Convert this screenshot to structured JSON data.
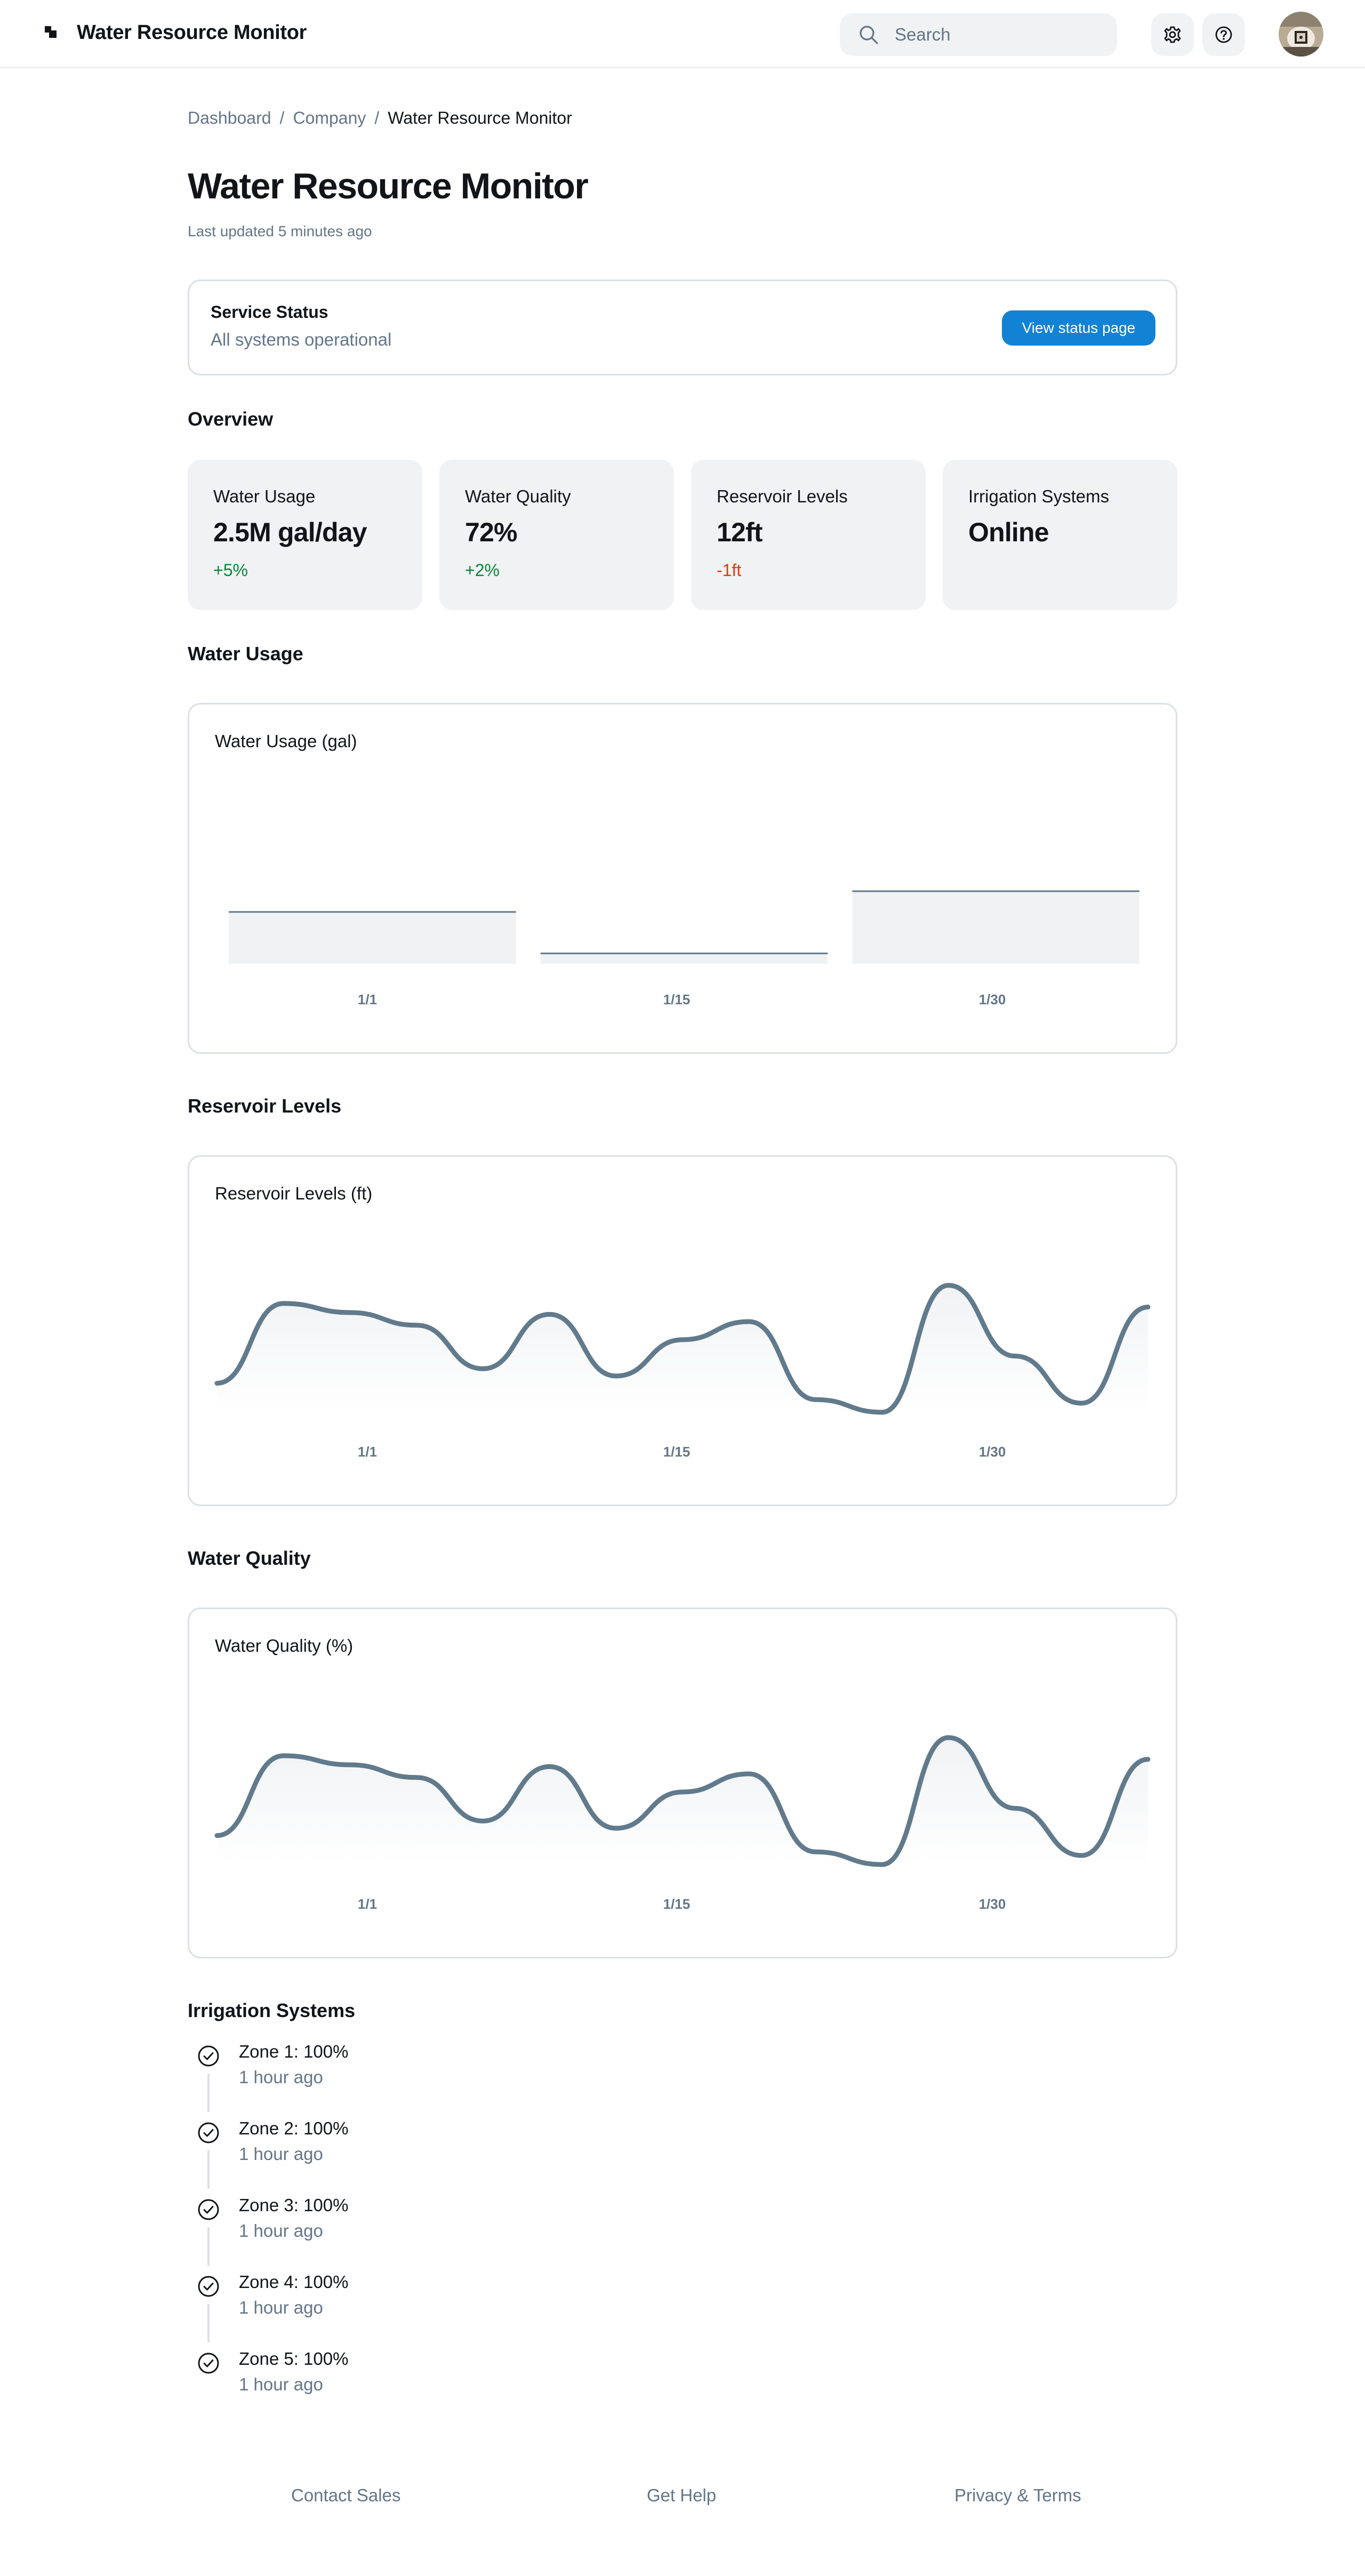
{
  "header": {
    "app_title": "Water Resource Monitor",
    "search_placeholder": "Search",
    "icons": [
      "logo-icon",
      "search-icon",
      "gear-icon",
      "help-icon",
      "avatar"
    ]
  },
  "breadcrumb": [
    "Dashboard",
    "Company",
    "Water Resource Monitor"
  ],
  "page": {
    "title": "Water Resource Monitor",
    "last_updated": "Last updated 5 minutes ago"
  },
  "service_status": {
    "title": "Service Status",
    "text": "All systems operational",
    "button_label": "View status page"
  },
  "sections": {
    "overview": "Overview",
    "water_usage": "Water Usage",
    "reservoir_levels": "Reservoir Levels",
    "water_quality": "Water Quality",
    "irrigation": "Irrigation Systems"
  },
  "stats": [
    {
      "label": "Water Usage",
      "value": "2.5M gal/day",
      "delta": "+5%",
      "trend": "positive"
    },
    {
      "label": "Water Quality",
      "value": "72%",
      "delta": "+2%",
      "trend": "positive"
    },
    {
      "label": "Reservoir Levels",
      "value": "12ft",
      "delta": "-1ft",
      "trend": "negative"
    },
    {
      "label": "Irrigation Systems",
      "value": "Online",
      "delta": "",
      "trend": "none"
    }
  ],
  "chart_data": [
    {
      "type": "bar",
      "title": "Water Usage (gal)",
      "categories": [
        "1/1",
        "1/15",
        "1/30"
      ],
      "values": [
        0.5,
        0.1,
        0.7
      ]
    },
    {
      "type": "area",
      "title": "Reservoir Levels (ft)",
      "tick_labels": [
        "1/1",
        "1/15",
        "1/30"
      ],
      "values": [
        0.11,
        0.55,
        0.5,
        0.43,
        0.19,
        0.49,
        0.15,
        0.35,
        0.45,
        0.02,
        -0.05,
        0.65,
        0.26,
        0.0,
        0.53
      ]
    },
    {
      "type": "area",
      "title": "Water Quality (%)",
      "tick_labels": [
        "1/1",
        "1/15",
        "1/30"
      ],
      "values": [
        0.11,
        0.55,
        0.5,
        0.43,
        0.19,
        0.49,
        0.15,
        0.35,
        0.45,
        0.02,
        -0.05,
        0.65,
        0.26,
        0.0,
        0.53
      ]
    }
  ],
  "irrigation": [
    {
      "title": "Zone 1: 100%",
      "time": "1 hour ago"
    },
    {
      "title": "Zone 2: 100%",
      "time": "1 hour ago"
    },
    {
      "title": "Zone 3: 100%",
      "time": "1 hour ago"
    },
    {
      "title": "Zone 4: 100%",
      "time": "1 hour ago"
    },
    {
      "title": "Zone 5: 100%",
      "time": "1 hour ago"
    }
  ],
  "footer": [
    "Contact Sales",
    "Get Help",
    "Privacy & Terms"
  ],
  "colors": {
    "accent": "#1283d4",
    "chart_line": "#617a8c",
    "chart_fill": "#f0f2f4",
    "positive": "#078838",
    "negative": "#e73908",
    "muted_text": "#637588"
  }
}
